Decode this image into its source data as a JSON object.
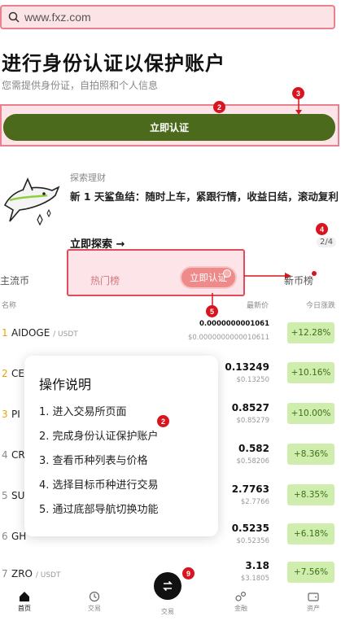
{
  "search": {
    "url": "www.fxz.com"
  },
  "hero": {
    "title": "进行身份认证以保护账户",
    "subtitle": "您需提供身份证，自拍照和个人信息",
    "verify_button": "立即认证"
  },
  "badges": [
    "2",
    "3",
    "4",
    "5",
    "2",
    "9"
  ],
  "promo": {
    "tag": "探索理财",
    "description": "新 1 天鲨鱼结：随时上车，紧跟行情，收益日结，滚动复利",
    "link": "立即探索 →",
    "page": "2/4"
  },
  "tabs": {
    "mainstream": "主流币",
    "hot": "热门榜",
    "verify_pill": "立即认证",
    "new": "新币榜"
  },
  "columns": {
    "name": "名称",
    "price": "最新价",
    "change": "今日涨跌"
  },
  "rows": [
    {
      "rank": "1",
      "symbol": "AIDOGE",
      "quote": "/ USDT",
      "price": "0.0000000001061",
      "sub": "$0.0000000000010611",
      "change": "+12.28%"
    },
    {
      "rank": "2",
      "symbol": "CE",
      "quote": "",
      "price": "0.13249",
      "sub": "$0.13250",
      "change": "+10.16%"
    },
    {
      "rank": "3",
      "symbol": "PI",
      "quote": "",
      "price": "0.8527",
      "sub": "$0.85279",
      "change": "+10.00%"
    },
    {
      "rank": "4",
      "symbol": "CR",
      "quote": "",
      "price": "0.582",
      "sub": "$0.58206",
      "change": "+8.36%"
    },
    {
      "rank": "5",
      "symbol": "SU",
      "quote": "",
      "price": "2.7763",
      "sub": "$2.7766",
      "change": "+8.35%"
    },
    {
      "rank": "6",
      "symbol": "GH",
      "quote": "",
      "price": "0.5235",
      "sub": "$0.52356",
      "change": "+6.18%"
    },
    {
      "rank": "7",
      "symbol": "ZRO",
      "quote": "/ USDT",
      "price": "3.18",
      "sub": "$3.1805",
      "change": "+7.56%"
    }
  ],
  "tooltip": {
    "title": "操作说明",
    "steps": [
      "1. 进入交易所页面",
      "2. 完成身份认证保护账户",
      "3. 查看币种列表与价格",
      "4. 选择目标币种进行交易",
      "5. 通过底部导航切换功能"
    ]
  },
  "nav": {
    "home": "首页",
    "markets": "交易",
    "trade": "交易",
    "earn": "金融",
    "assets": "资产"
  },
  "colors": {
    "accent_green": "#4c6a1c",
    "highlight_red": "#e24b59",
    "badge_red": "#d8141f",
    "change_bg": "#cfeeae"
  }
}
